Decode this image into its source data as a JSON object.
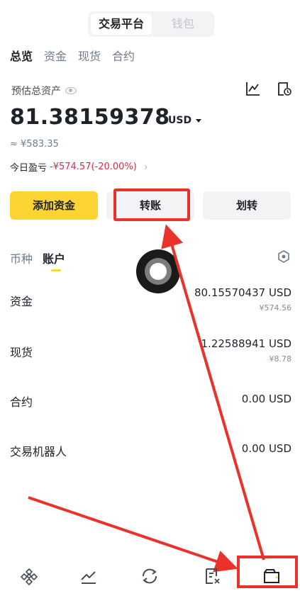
{
  "top_toggle": {
    "active": "交易平台",
    "inactive": "钱包"
  },
  "subtabs": [
    "总览",
    "资金",
    "现货",
    "合约"
  ],
  "summary": {
    "label": "预估总资产",
    "amount": "81.38159378",
    "currency": "USD",
    "approx": "≈ ¥583.35",
    "pnl_label": "今日盈亏",
    "pnl_value": "-¥574.57(-20.00%)"
  },
  "actions": {
    "add_funds": "添加资金",
    "transfer": "转账",
    "move": "划转"
  },
  "list_tabs": [
    "币种",
    "账户"
  ],
  "accounts": [
    {
      "name": "资金",
      "amount": "80.15570437 USD",
      "sub": "¥574.56"
    },
    {
      "name": "现货",
      "amount": "1.22588941 USD",
      "sub": "¥8.78"
    },
    {
      "name": "合约",
      "amount": "0.00 USD",
      "sub": ""
    },
    {
      "name": "交易机器人",
      "amount": "0.00 USD",
      "sub": ""
    }
  ],
  "colors": {
    "accent": "#fcd535",
    "loss": "#cf304a",
    "annotation": "#e8322a"
  },
  "nav_icons": [
    "home-icon",
    "markets-icon",
    "trade-icon",
    "orders-icon",
    "wallet-icon"
  ]
}
